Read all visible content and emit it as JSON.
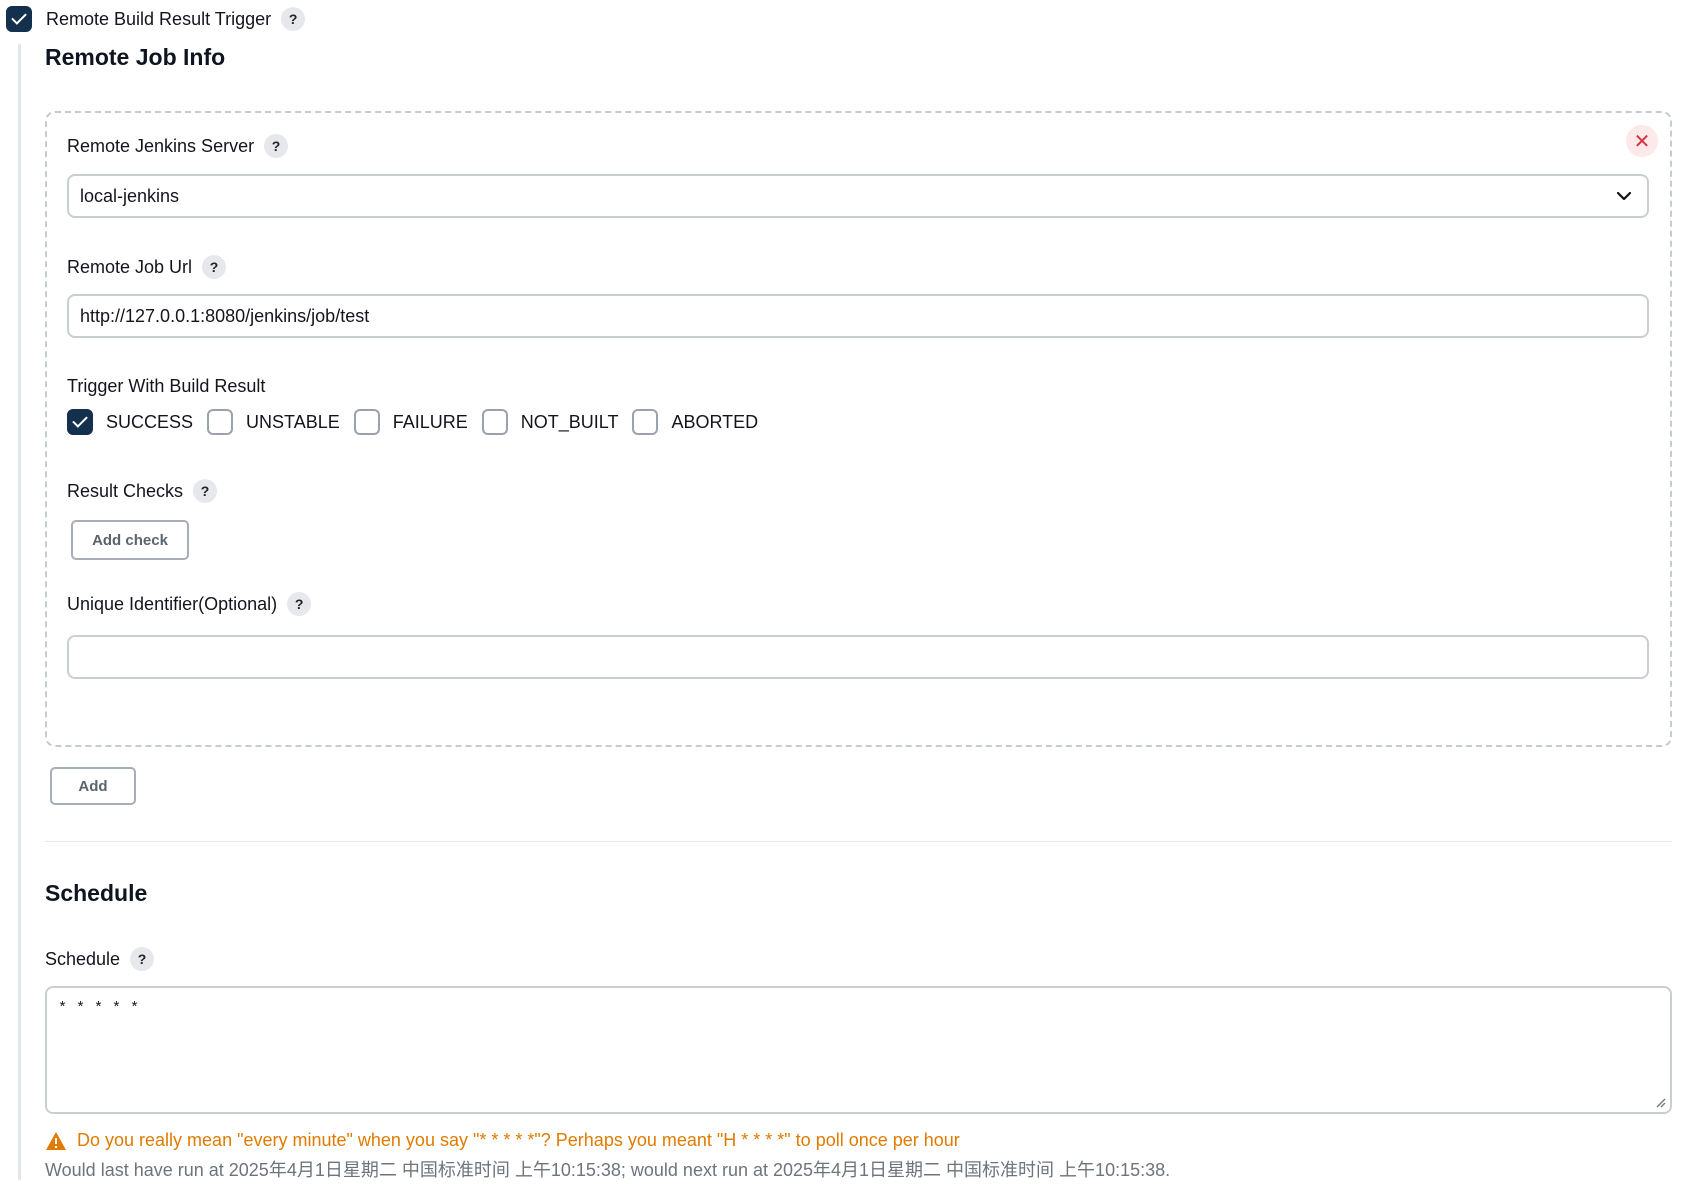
{
  "trigger": {
    "label": "Remote Build Result Trigger",
    "checked": true,
    "help": "?"
  },
  "remote_job_info": {
    "title": "Remote Job Info",
    "server": {
      "label": "Remote Jenkins Server",
      "help": "?",
      "value": "local-jenkins"
    },
    "job_url": {
      "label": "Remote Job Url",
      "help": "?",
      "value": "http://127.0.0.1:8080/jenkins/job/test"
    },
    "build_result": {
      "label": "Trigger With Build Result",
      "options": [
        {
          "label": "SUCCESS",
          "checked": true
        },
        {
          "label": "UNSTABLE",
          "checked": false
        },
        {
          "label": "FAILURE",
          "checked": false
        },
        {
          "label": "NOT_BUILT",
          "checked": false
        },
        {
          "label": "ABORTED",
          "checked": false
        }
      ]
    },
    "result_checks": {
      "label": "Result Checks",
      "help": "?",
      "button": "Add check"
    },
    "unique_id": {
      "label": "Unique Identifier(Optional)",
      "help": "?",
      "value": ""
    },
    "close_icon": "close-icon"
  },
  "add_button": "Add",
  "schedule": {
    "title": "Schedule",
    "label": "Schedule",
    "help": "?",
    "value": "* * * * *",
    "warning": "Do you really mean \"every minute\" when you say \"* * * * *\"? Perhaps you meant \"H * * * *\" to poll once per hour",
    "info": "Would last have run at 2025年4月1日星期二 中国标准时间 上午10:15:38; would next run at 2025年4月1日星期二 中国标准时间 上午10:15:38."
  },
  "colors": {
    "accent": "#14304f",
    "warning": "#e07b00",
    "danger": "#d2333f"
  }
}
